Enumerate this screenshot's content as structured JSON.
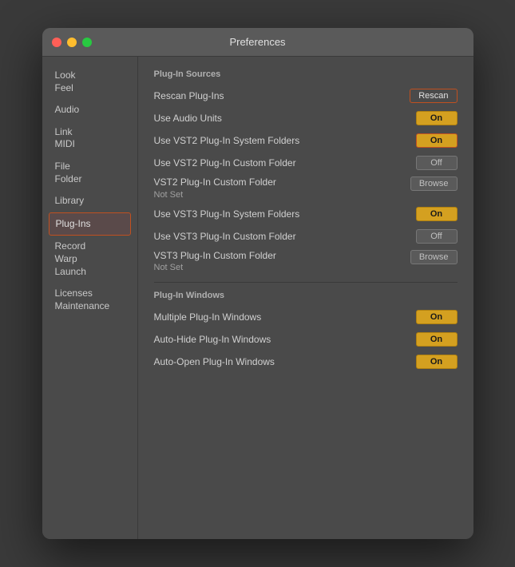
{
  "window": {
    "title": "Preferences"
  },
  "sidebar": {
    "items": [
      {
        "id": "look-feel",
        "label": "Look\nFeel",
        "active": false
      },
      {
        "id": "audio",
        "label": "Audio",
        "active": false
      },
      {
        "id": "link-midi",
        "label": "Link\nMIDI",
        "active": false
      },
      {
        "id": "file-folder",
        "label": "File\nFolder",
        "active": false
      },
      {
        "id": "library",
        "label": "Library",
        "active": false
      },
      {
        "id": "plug-ins",
        "label": "Plug-Ins",
        "active": true
      },
      {
        "id": "record-warp-launch",
        "label": "Record\nWarp\nLaunch",
        "active": false
      },
      {
        "id": "licenses-maintenance",
        "label": "Licenses\nMaintenance",
        "active": false
      }
    ]
  },
  "main": {
    "plug_in_sources_title": "Plug-In Sources",
    "plug_in_windows_title": "Plug-In Windows",
    "rows": [
      {
        "id": "rescan",
        "label": "Rescan Plug-Ins",
        "btn_label": "Rescan",
        "btn_type": "rescan"
      },
      {
        "id": "use-audio-units",
        "label": "Use Audio Units",
        "btn_label": "On",
        "btn_type": "on"
      },
      {
        "id": "use-vst2-system",
        "label": "Use VST2 Plug-In System Folders",
        "btn_label": "On",
        "btn_type": "on-active"
      },
      {
        "id": "use-vst2-custom",
        "label": "Use VST2 Plug-In Custom Folder",
        "btn_label": "Off",
        "btn_type": "off"
      },
      {
        "id": "vst2-custom-folder",
        "label": "VST2 Plug-In Custom Folder",
        "sublabel": "Not Set",
        "btn_label": "Browse",
        "btn_type": "browse"
      },
      {
        "id": "use-vst3-system",
        "label": "Use VST3 Plug-In System Folders",
        "btn_label": "On",
        "btn_type": "on"
      },
      {
        "id": "use-vst3-custom",
        "label": "Use VST3 Plug-In Custom Folder",
        "btn_label": "Off",
        "btn_type": "off"
      },
      {
        "id": "vst3-custom-folder",
        "label": "VST3 Plug-In Custom Folder",
        "sublabel": "Not Set",
        "btn_label": "Browse",
        "btn_type": "browse"
      }
    ],
    "window_rows": [
      {
        "id": "multiple-windows",
        "label": "Multiple Plug-In Windows",
        "btn_label": "On",
        "btn_type": "on"
      },
      {
        "id": "auto-hide",
        "label": "Auto-Hide Plug-In Windows",
        "btn_label": "On",
        "btn_type": "on"
      },
      {
        "id": "auto-open",
        "label": "Auto-Open Plug-In Windows",
        "btn_label": "On",
        "btn_type": "on"
      }
    ]
  }
}
